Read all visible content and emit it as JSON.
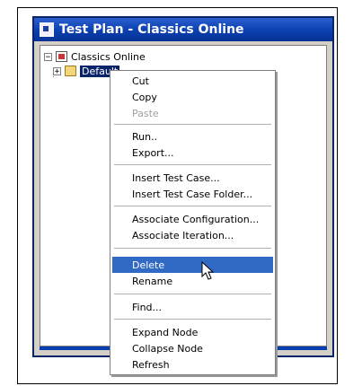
{
  "window": {
    "title": "Test Plan - Classics Online"
  },
  "tree": {
    "root_label": "Classics Online",
    "child_label": "Default",
    "root_expander": "−",
    "child_expander": "+"
  },
  "context_menu": {
    "items": [
      {
        "label": "Cut",
        "state": "normal"
      },
      {
        "label": "Copy",
        "state": "normal"
      },
      {
        "label": "Paste",
        "state": "disabled"
      },
      {
        "label": "Run..",
        "state": "normal"
      },
      {
        "label": "Export...",
        "state": "normal"
      },
      {
        "label": "Insert Test Case...",
        "state": "normal"
      },
      {
        "label": "Insert Test Case Folder...",
        "state": "normal"
      },
      {
        "label": "Associate Configuration...",
        "state": "normal"
      },
      {
        "label": "Associate Iteration...",
        "state": "normal"
      },
      {
        "label": "Delete",
        "state": "highlighted"
      },
      {
        "label": "Rename",
        "state": "normal"
      },
      {
        "label": "Find...",
        "state": "normal"
      },
      {
        "label": "Expand Node",
        "state": "normal"
      },
      {
        "label": "Collapse Node",
        "state": "normal"
      },
      {
        "label": "Refresh",
        "state": "normal"
      }
    ]
  },
  "colors": {
    "titlebar": "#0a3fb0",
    "selection": "#0a246a",
    "menu_highlight": "#316ac5"
  },
  "icons": {
    "app": "test-plan-icon",
    "root": "test-plan-icon",
    "child": "folder-icon",
    "pointer": "mouse-pointer-icon"
  }
}
